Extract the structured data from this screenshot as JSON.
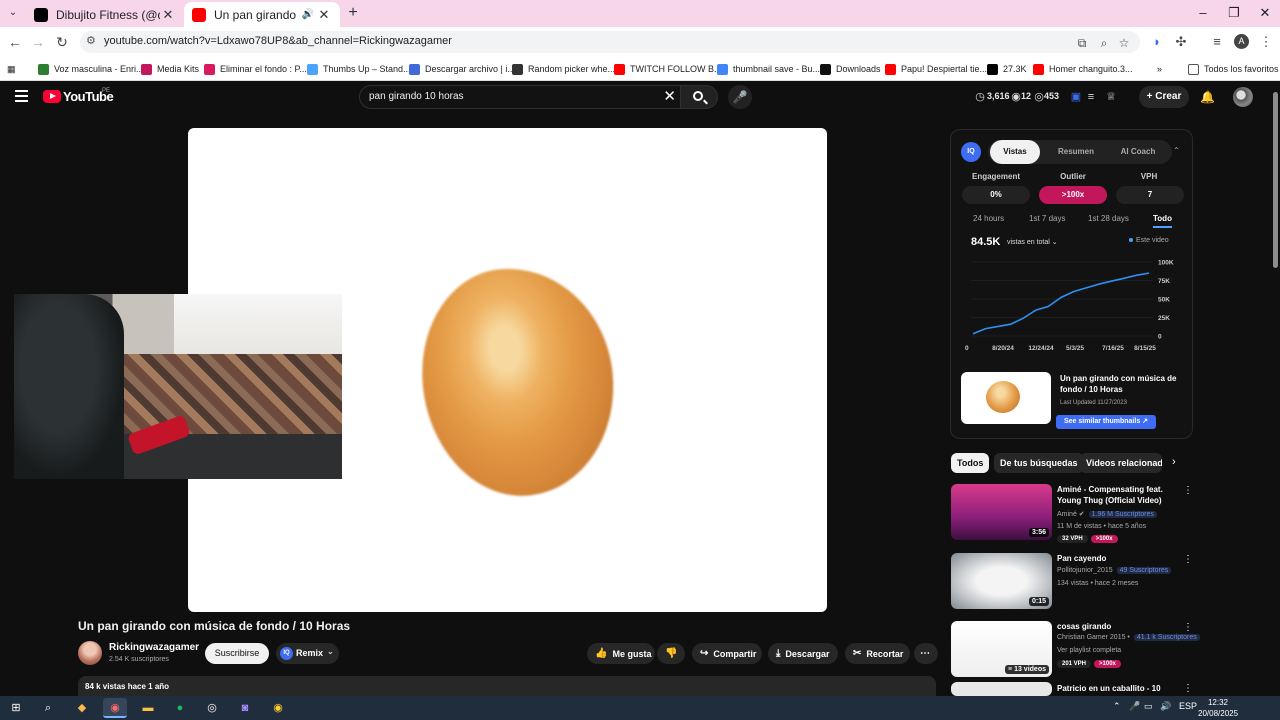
{
  "browser": {
    "tabs": [
      {
        "title": "Dibujito Fitness (@dibujito_fitn",
        "favicon_color": "#000000"
      },
      {
        "title": "Un pan girando con música",
        "favicon_color": "#ff0000"
      }
    ],
    "url": "youtube.com/watch?v=Ldxawo78UP8&ab_channel=Rickingwazagamer",
    "profile_initial": "A",
    "bookmarks": [
      {
        "label": "Voz masculina - Enri...",
        "color": "#2f7d32"
      },
      {
        "label": "Media Kits",
        "color": "#c2185b"
      },
      {
        "label": "Eliminar el fondo : P...",
        "color": "#d81b60"
      },
      {
        "label": "Thumbs Up – Stand...",
        "color": "#4aa3ff"
      },
      {
        "label": "Descargar archivo | i...",
        "color": "#3f6ad8"
      },
      {
        "label": "Random picker whe...",
        "color": "#333333"
      },
      {
        "label": "TWITCH FOLLOW B...",
        "color": "#ff0000"
      },
      {
        "label": "thumbnail save - Bu...",
        "color": "#4285f4"
      },
      {
        "label": "Downloads",
        "color": "#111111"
      },
      {
        "label": "Papu! Despiertal tie...",
        "color": "#ff0000"
      },
      {
        "label": "27.3K",
        "color": "#000000"
      },
      {
        "label": "Homer changuito.3...",
        "color": "#ff0000"
      }
    ],
    "all_bookmarks": "Todos los favoritos"
  },
  "header": {
    "logo_text": "YouTube",
    "country": "PE",
    "search_query": "pan girando 10 horas",
    "stats": [
      "3,616",
      "12",
      "453"
    ],
    "create_label": "Crear"
  },
  "video": {
    "title": "Un pan girando con música de fondo / 10 Horas",
    "channel": "Rickingwazagamer",
    "subscribers": "2.54 K suscriptores",
    "subscribe_label": "Suscribirse",
    "remix_label": "Remix",
    "actions": [
      "Me gusta",
      "Compartir",
      "Descargar",
      "Recortar"
    ],
    "description_meta": "84 k vistas  hace 1 año"
  },
  "panel": {
    "logo": "IQ",
    "tabs": [
      "Vistas",
      "Resumen",
      "AI Coach"
    ],
    "metrics": [
      {
        "label": "Engagement",
        "value": "0%"
      },
      {
        "label": "Outlier",
        "value": ">100x"
      },
      {
        "label": "VPH",
        "value": "7"
      }
    ],
    "ranges": [
      "24 hours",
      "1st 7 days",
      "1st 28 days",
      "Todo"
    ],
    "views_total": "84.5K",
    "views_selector": "vistas en total ⌄",
    "legend": "Este video",
    "card_title": "Un pan girando con música de fondo / 10 Horas",
    "card_updated": "Last Updated 11/27/2023",
    "card_button": "See similar thumbnails ↗"
  },
  "chart_data": {
    "type": "line",
    "x": [
      "8/20/24",
      "12/24/24",
      "5/3/25",
      "7/16/25",
      "8/15/25"
    ],
    "xticks": [
      "0",
      "8/20/24",
      "12/24/24",
      "5/3/25",
      "7/16/25",
      "8/15/25"
    ],
    "yticks": [
      "100K",
      "75K",
      "50K",
      "25K",
      "0"
    ],
    "ylim": [
      0,
      100000
    ],
    "series": [
      {
        "name": "Este video",
        "color": "#2f8ff0",
        "values": [
          3000,
          10000,
          13000,
          16000,
          24000,
          35000,
          40000,
          52000,
          60000,
          65000,
          70000,
          74000,
          78000,
          82000,
          85000
        ]
      }
    ],
    "grid": true
  },
  "chips": [
    "Todos",
    "De tus búsquedas",
    "Videos relacionado"
  ],
  "related": [
    {
      "title": "Aminé - Compensating feat. Young Thug (Official Video)",
      "channel": "Aminé ✔",
      "subs": "1.96 M Suscriptores",
      "meta": "11 M de vistas • hace 5 años",
      "vph": "32 VPH",
      "outlier": ">100x",
      "duration": "3:56"
    },
    {
      "title": "Pan cayendo",
      "channel": "Pollitojunior_2015",
      "subs": "49 Suscriptores",
      "meta": "134 vistas • hace 2 meses",
      "duration": "0:15"
    },
    {
      "title": "cosas girando",
      "channel": "Christian Gamer 2015 •",
      "subs": "41.1 k Suscriptores",
      "meta": "Ver playlist completa",
      "vph": "201 VPH",
      "outlier": ">100x",
      "duration": "13 videos"
    },
    {
      "title": "Patricio en un caballito - 10"
    }
  ],
  "taskbar": {
    "lang": "ESP",
    "time": "12:32",
    "date": "20/08/2025"
  }
}
